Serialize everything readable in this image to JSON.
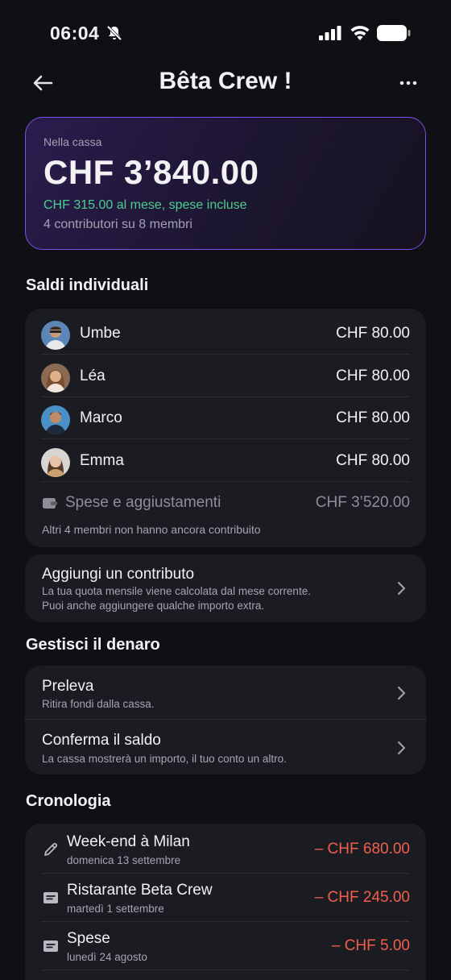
{
  "status": {
    "time": "06:04"
  },
  "nav": {
    "title": "Bêta Crew !"
  },
  "hero": {
    "label": "Nella cassa",
    "amount": "CHF 3’840.00",
    "monthly": "CHF 315.00 al mese, spese incluse",
    "members": "4 contributori su 8 membri",
    "accent_color": "#7b52e6"
  },
  "balances": {
    "title": "Saldi individuali",
    "rows": [
      {
        "name": "Umbe",
        "amount": "CHF 80.00"
      },
      {
        "name": "Léa",
        "amount": "CHF 80.00"
      },
      {
        "name": "Marco",
        "amount": "CHF 80.00"
      },
      {
        "name": "Emma",
        "amount": "CHF 80.00"
      }
    ],
    "expenses_label": "Spese e aggiustamenti",
    "expenses_amount": "CHF 3’520.00",
    "footnote": "Altri 4 membri non hanno ancora contribuito"
  },
  "contribution": {
    "title": "Aggiungi un contributo",
    "sub1": "La tua quota mensile viene calcolata dal mese corrente.",
    "sub2": "Puoi anche aggiungere qualche importo extra."
  },
  "manage": {
    "title": "Gestisci il denaro",
    "withdraw_title": "Preleva",
    "withdraw_sub": "Ritira fondi dalla cassa.",
    "confirm_title": "Conferma il saldo",
    "confirm_sub": "La cassa mostrerà un importo, il tuo conto un altro."
  },
  "history": {
    "title": "Cronologia",
    "items": [
      {
        "title": "Week-end à Milan",
        "date": "domenica 13 settembre",
        "amount": "– CHF 680.00",
        "icon": "pencil-icon"
      },
      {
        "title": "Ristarante Beta Crew",
        "date": "martedì 1 settembre",
        "amount": "– CHF 245.00",
        "icon": "receipt-icon"
      },
      {
        "title": "Spese",
        "date": "lunedì 24 agosto",
        "amount": "– CHF 5.00",
        "icon": "receipt-icon"
      }
    ],
    "negative_color": "#f0604c"
  }
}
